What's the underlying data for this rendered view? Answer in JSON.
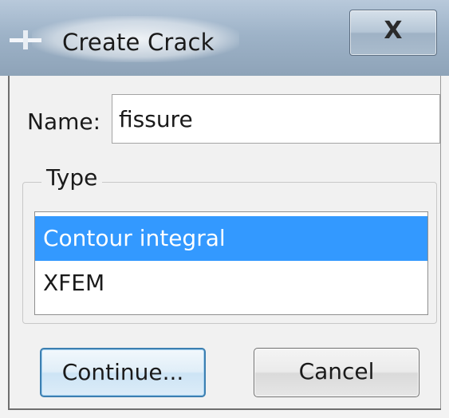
{
  "window": {
    "title": "Create Crack",
    "close_icon": "close-icon",
    "close_label": "X"
  },
  "name_field": {
    "label": "Name:",
    "value": "fissure"
  },
  "type_group": {
    "legend": "Type",
    "options": [
      "Contour integral",
      "XFEM"
    ],
    "selected": "Contour integral"
  },
  "buttons": {
    "continue_label": "Continue...",
    "cancel_label": "Cancel"
  },
  "colors": {
    "selection": "#3399ff",
    "titlebar": "#9eb3c8"
  }
}
